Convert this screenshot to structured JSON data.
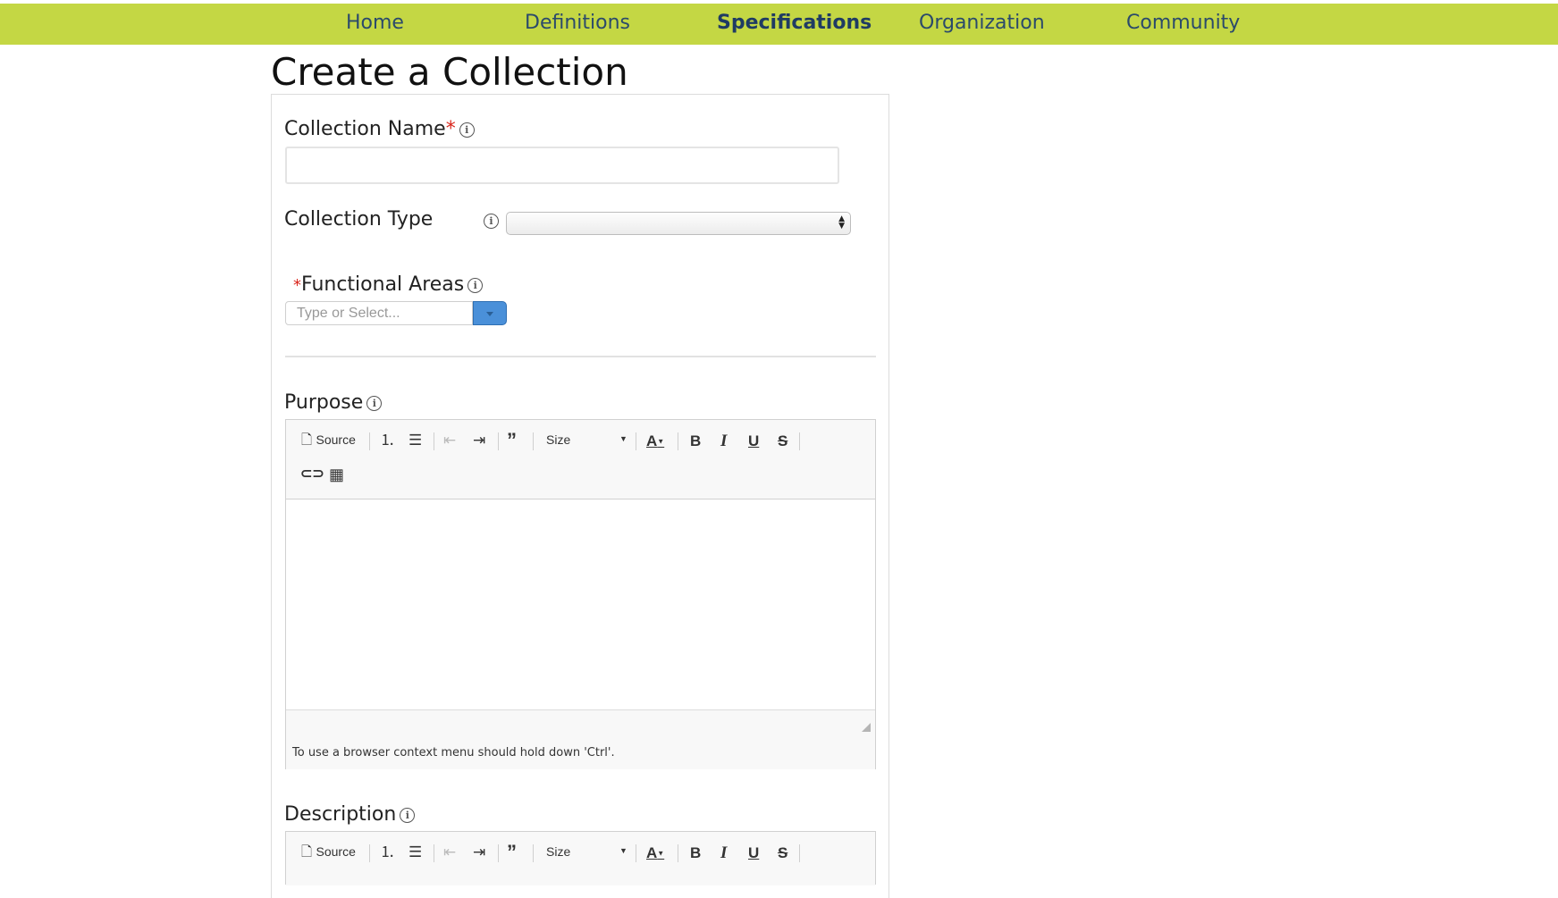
{
  "nav": {
    "items": [
      {
        "label": "Home"
      },
      {
        "label": "Definitions"
      },
      {
        "label": "Specifications"
      },
      {
        "label": "Organization"
      },
      {
        "label": "Community"
      }
    ],
    "active": "Specifications",
    "background_color": "#c4d744"
  },
  "page": {
    "title": "Create a Collection"
  },
  "form": {
    "collection_name": {
      "label": "Collection Name",
      "required_mark": "*",
      "value": ""
    },
    "collection_type": {
      "label": "Collection Type",
      "selected": ""
    },
    "functional_areas": {
      "label": "Functional Areas",
      "required_mark": "*",
      "placeholder": "Type or Select..."
    },
    "purpose": {
      "label": "Purpose",
      "content": ""
    },
    "description": {
      "label": "Description",
      "content": ""
    }
  },
  "editor": {
    "toolbar": {
      "source_label": "Source",
      "size_label": "Size",
      "text_color_label": "A",
      "bold_label": "B",
      "italic_label": "I",
      "underline_label": "U",
      "strike_label": "S"
    },
    "status_hint": "To use a browser context menu should hold down 'Ctrl'."
  },
  "icons": [
    "info-icon",
    "source-icon",
    "numbered-list-icon",
    "bulleted-list-icon",
    "outdent-icon",
    "indent-icon",
    "blockquote-icon",
    "link-icon",
    "table-icon",
    "resize-handle-icon"
  ],
  "colors": {
    "accent_button": "#4a90d9",
    "required": "#d9261c",
    "nav_text": "#2b4a6b"
  }
}
